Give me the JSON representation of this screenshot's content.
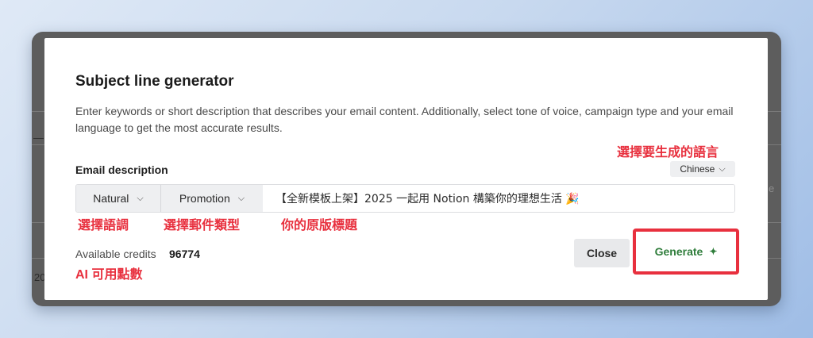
{
  "modal": {
    "title": "Subject line generator",
    "description": "Enter keywords or short description that describes your email content. Additionally, select tone of voice, campaign type and your email language to get the most accurate results.",
    "email_description_label": "Email description",
    "language": {
      "selected": "Chinese",
      "icon": "chevron-down-icon"
    },
    "tone": {
      "selected": "Natural",
      "icon": "chevron-down-icon"
    },
    "campaign_type": {
      "selected": "Promotion",
      "icon": "chevron-down-icon"
    },
    "subject_value": "【全新模板上架】2025 一起用 Notion 構築你的理想生活 🎉",
    "credits": {
      "label": "Available credits",
      "value": "96774"
    },
    "buttons": {
      "close": "Close",
      "generate": "Generate",
      "generate_icon": "sparkle-icon"
    }
  },
  "annotations": {
    "language": "選擇要生成的語言",
    "tone": "選擇語調",
    "type": "選擇郵件類型",
    "title": "你的原版標題",
    "credits": "AI 可用點數"
  },
  "background": {
    "row_text_1": "—",
    "row_text_2": "20",
    "row_text_3": "e"
  },
  "colors": {
    "annotation": "#e8303e",
    "generate_text": "#2f7d3b",
    "highlight_border": "#e8303e"
  }
}
